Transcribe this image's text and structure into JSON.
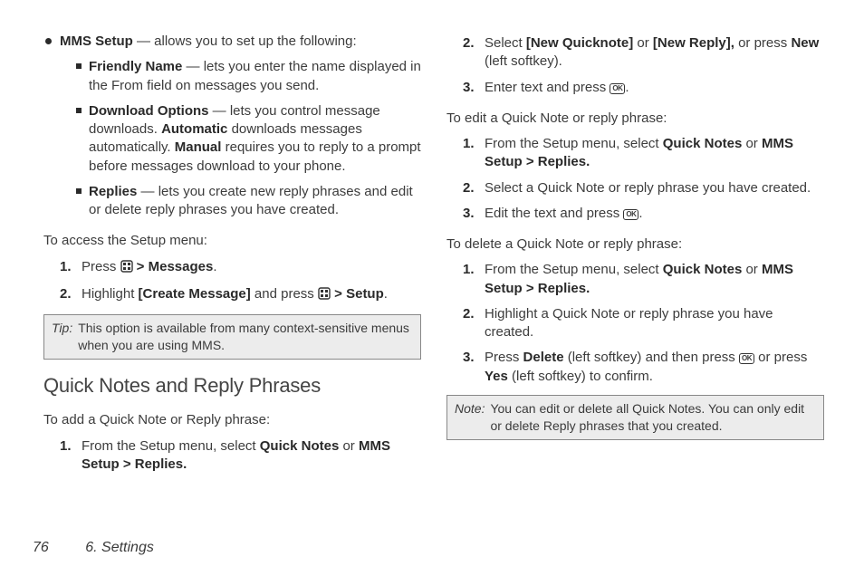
{
  "col1": {
    "mms_label": "MMS Setup",
    "mms_rest": " — allows you to set up the following:",
    "friendly_label": "Friendly Name",
    "friendly_rest": " — lets you enter the name displayed in the From field on messages you send.",
    "download_label": "Download Options",
    "download_p1": " — lets you control message downloads. ",
    "download_auto": "Automatic",
    "download_p2": " downloads messages automatically. ",
    "download_manual": "Manual",
    "download_p3": " requires you to reply to a prompt before messages download to your phone.",
    "replies_label": "Replies",
    "replies_rest": " — lets you create new reply phrases and edit or delete reply phrases you have created.",
    "access_setup": "To access the Setup menu:",
    "step1_a": "Press ",
    "step1_b": " > ",
    "step1_c": "Messages",
    "step1_d": ".",
    "step2_a": "Highlight ",
    "step2_b": "[Create Message]",
    "step2_c": " and press ",
    "step2_d": " > ",
    "step2_e": "Setup",
    "step2_f": ".",
    "tip_label": "Tip:",
    "tip_text": "This option is available from many context-sensitive menus when you are using MMS.",
    "h3": "Quick Notes and Reply Phrases",
    "add_intro": "To add a Quick Note or Reply phrase:",
    "add1_a": "From the Setup menu, select ",
    "add1_b": "Quick Notes",
    "add1_c": " or ",
    "add1_d": "MMS Setup > Replies."
  },
  "col2": {
    "s2_a": "Select ",
    "s2_b": "[New Quicknote]",
    "s2_c": " or ",
    "s2_d": "[New Reply],",
    "s2_e": " or press ",
    "s2_f": "New",
    "s2_g": " (left softkey).",
    "s3_a": "Enter text and press ",
    "s3_b": ".",
    "edit_intro": "To edit a Quick Note or reply phrase:",
    "e1_a": "From the Setup menu, select ",
    "e1_b": "Quick Notes",
    "e1_c": " or ",
    "e1_d": "MMS Setup > Replies.",
    "e2": "Select a Quick Note or reply phrase you have created.",
    "e3_a": "Edit the text and press ",
    "e3_b": ".",
    "del_intro": "To delete a Quick Note or reply phrase:",
    "d1_a": "From the Setup menu, select ",
    "d1_b": "Quick Notes",
    "d1_c": " or ",
    "d1_d": "MMS Setup > Replies.",
    "d2": "Highlight a Quick Note or reply phrase you have created.",
    "d3_a": "Press ",
    "d3_b": "Delete",
    "d3_c": " (left softkey) and then press ",
    "d3_d": " or press ",
    "d3_e": "Yes",
    "d3_f": " (left softkey) to confirm.",
    "note_label": "Note:",
    "note_text": "You can edit or delete all Quick Notes. You can only edit or delete Reply phrases that you created."
  },
  "footer": {
    "page_num": "76",
    "section": "6. Settings"
  },
  "keys": {
    "ok": "OK"
  }
}
